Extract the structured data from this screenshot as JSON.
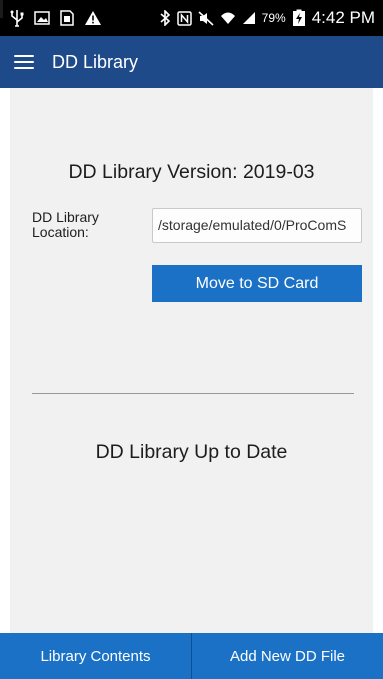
{
  "status_bar": {
    "battery_percent": "79%",
    "time": "4:42 PM",
    "icons_left": [
      "usb-icon",
      "image-icon",
      "sim-card-icon",
      "warning-icon"
    ],
    "icons_right": [
      "bluetooth-icon",
      "nfc-icon",
      "mute-icon",
      "wifi-icon",
      "signal-icon",
      "battery-charging-icon"
    ]
  },
  "app_bar": {
    "title": "DD Library",
    "menu_icon": "hamburger-menu-icon",
    "color": "#1f4a8a"
  },
  "main": {
    "version_text": "DD Library Version: 2019-03",
    "location_label": "DD Library Location:",
    "location_value": "/storage/emulated/0/ProComS",
    "move_button_label": "Move to SD Card",
    "status_text": "DD Library Up to Date"
  },
  "bottom_bar": {
    "library_contents_label": "Library Contents",
    "add_new_label": "Add New DD File",
    "color": "#1a71c6"
  }
}
